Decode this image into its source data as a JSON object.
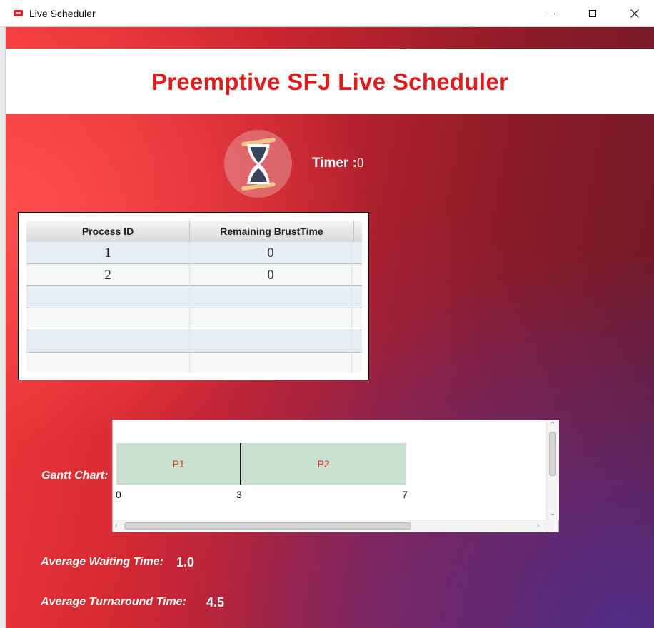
{
  "window": {
    "title": "Live Scheduler",
    "buttons": [
      "minimize-icon",
      "maximize-icon",
      "close-icon"
    ]
  },
  "header": {
    "title": "Preemptive SFJ Live Scheduler"
  },
  "timer": {
    "label": "Timer :",
    "value": "0",
    "icon": "hourglass-icon"
  },
  "process_table": {
    "columns": [
      "Process ID",
      "Remaining BrustTime"
    ],
    "rows": [
      {
        "pid": "1",
        "remaining": "0"
      },
      {
        "pid": "2",
        "remaining": "0"
      },
      {
        "pid": "",
        "remaining": ""
      },
      {
        "pid": "",
        "remaining": ""
      },
      {
        "pid": "",
        "remaining": ""
      },
      {
        "pid": "",
        "remaining": ""
      }
    ]
  },
  "gantt": {
    "label": "Gantt Chart:",
    "segments": [
      {
        "name": "P1",
        "start": 0,
        "end": 3
      },
      {
        "name": "P2",
        "start": 3,
        "end": 7
      }
    ],
    "ticks": [
      "0",
      "3",
      "7"
    ],
    "bar_color": "#c9dfcf",
    "text_color": "#cc2f1f"
  },
  "stats": {
    "avg_waiting_label": "Average Waiting Time:",
    "avg_waiting_value": "1.0",
    "avg_turnaround_label": "Average Turnaround Time:",
    "avg_turnaround_value": "4.5"
  },
  "colors": {
    "title_red": "#e11a1a",
    "background_start": "#f43a3c",
    "background_end": "#6b1a2a"
  }
}
